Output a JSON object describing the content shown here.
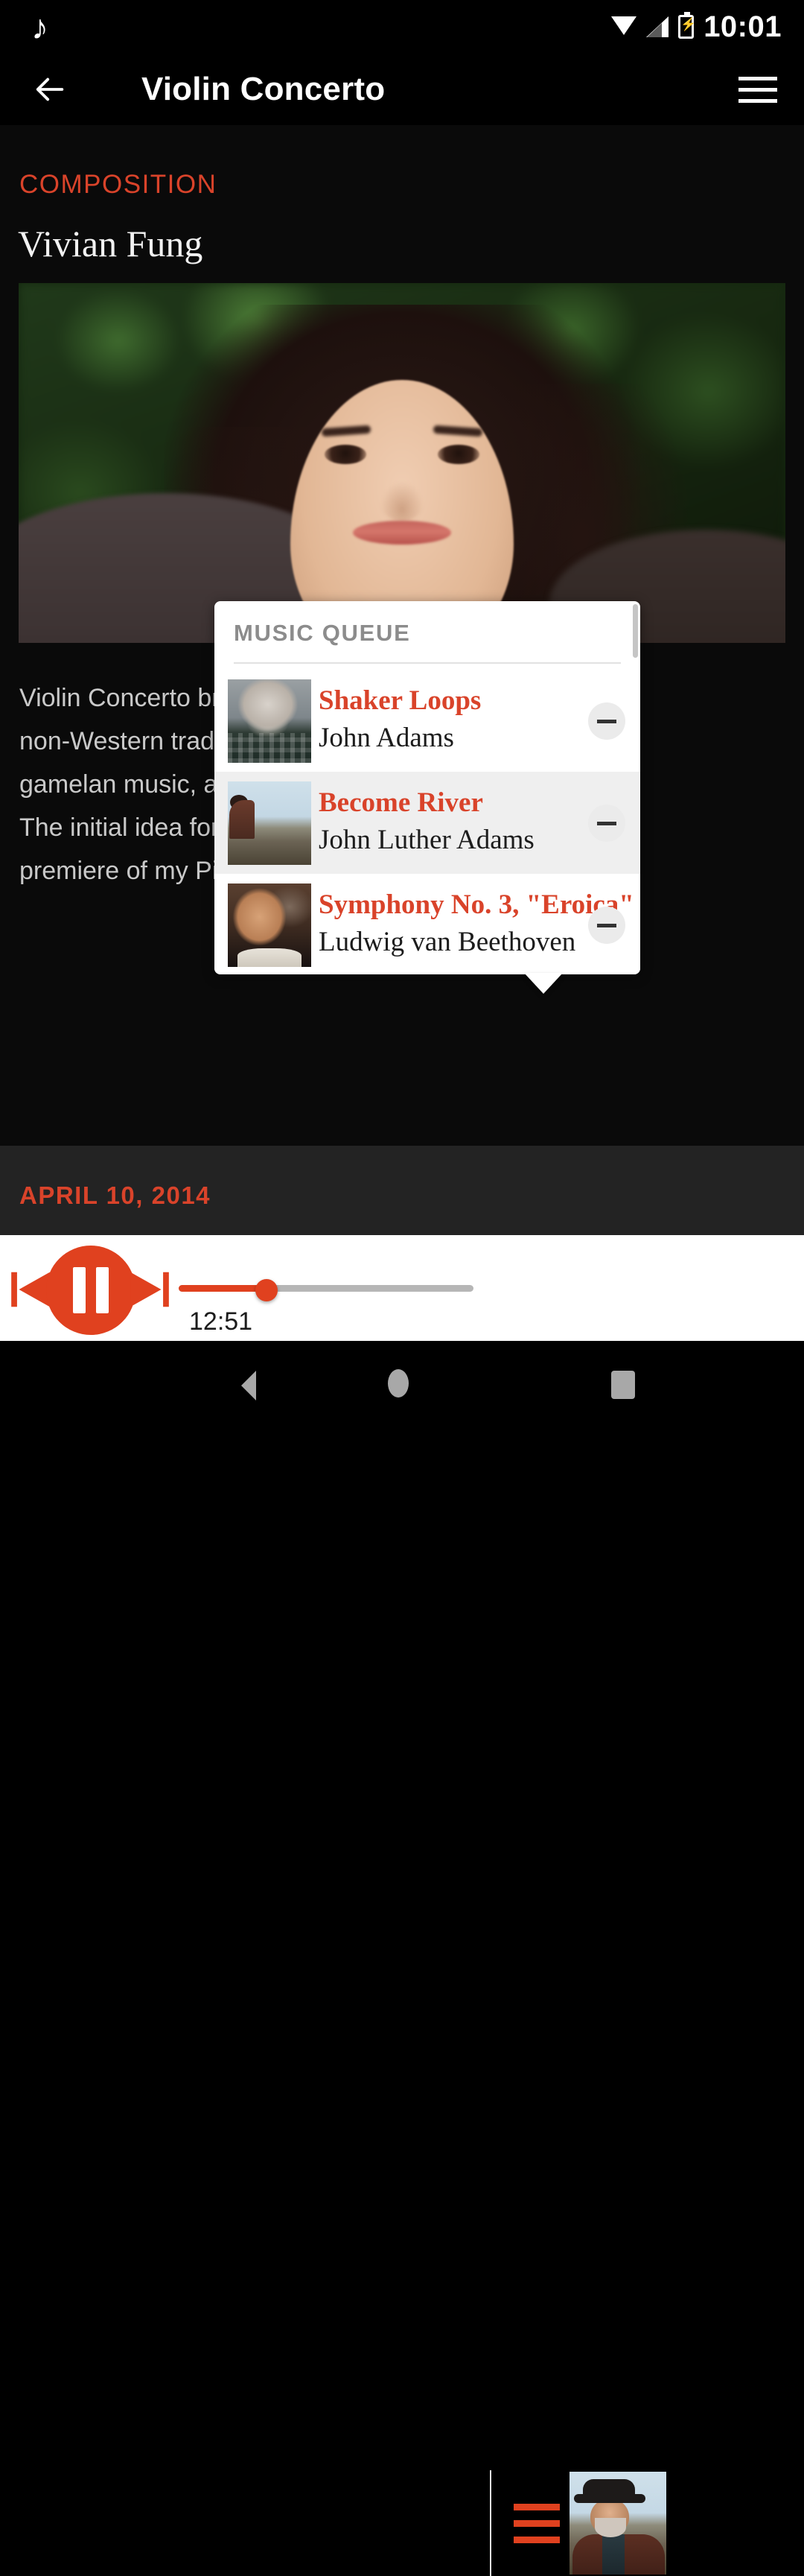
{
  "status_bar": {
    "music_icon": "music-note-icon",
    "wifi_icon": "wifi-icon",
    "signal_icon": "cell-signal-icon",
    "battery_icon": "battery-charging-icon",
    "time": "10:01"
  },
  "app_bar": {
    "back_icon": "back-arrow-icon",
    "title": "Violin Concerto",
    "menu_icon": "hamburger-menu-icon"
  },
  "article": {
    "kicker": "COMPOSITION",
    "composer": "Vivian Fung",
    "hero_image_alt": "portrait-of-vivian-fung",
    "body": "Violin Concerto brings together Western and\nnon-Western traditions, drawing on Balinese\ngamelan music, and other influences.\nThe initial idea for the work came after the\npremiere of my Piano Concerto.",
    "date": "APRIL 10, 2014"
  },
  "queue_popup": {
    "title": "MUSIC QUEUE",
    "items": [
      {
        "thumb": "portrait-john-adams",
        "thumb_class": "th-adams",
        "title": "Shaker Loops",
        "artist": "John Adams",
        "remove_icon": "minus-icon",
        "highlighted": false
      },
      {
        "thumb": "landscape-become-river",
        "thumb_class": "th-river",
        "title": "Become River",
        "artist": "John Luther Adams",
        "remove_icon": "minus-icon",
        "highlighted": true
      },
      {
        "thumb": "portrait-beethoven",
        "thumb_class": "th-beet",
        "title": "Symphony No. 3, \"Eroica\"",
        "artist": "Ludwig van Beethoven",
        "remove_icon": "minus-icon",
        "highlighted": false
      }
    ]
  },
  "player": {
    "prev_icon": "skip-previous-icon",
    "play_pause_icon": "pause-icon",
    "next_icon": "skip-next-icon",
    "elapsed": "12:51",
    "progress_percent": 29,
    "queue_icon": "queue-list-icon",
    "now_playing_art": "album-art-john-luther-adams",
    "accent_color": "#e0411f",
    "track_color": "#b6b6b6"
  },
  "nav_bar": {
    "back_icon": "nav-back-icon",
    "home_icon": "nav-home-icon",
    "recents_icon": "nav-recents-icon"
  },
  "colors": {
    "accent_red": "#d9432a",
    "player_red": "#e0411f",
    "page_bg": "#0a0a0a",
    "date_bg": "#232323",
    "queue_title_gray": "#8c8c8c",
    "body_gray": "#c9c9c9"
  }
}
